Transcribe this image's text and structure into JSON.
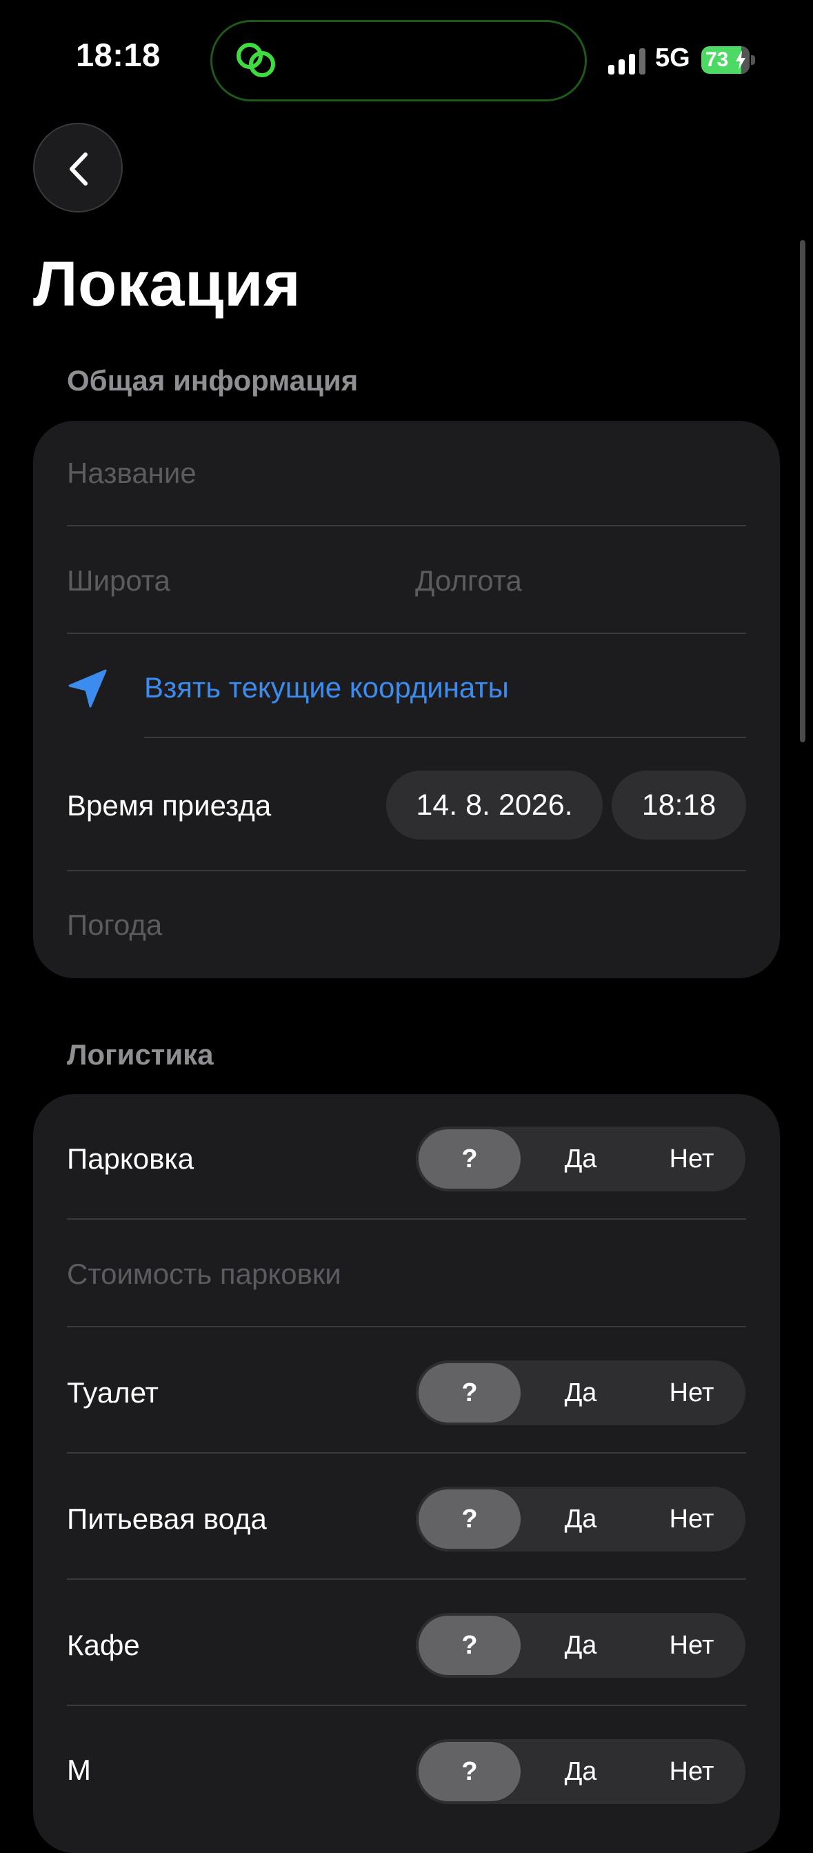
{
  "status_bar": {
    "time": "18:18",
    "network": "5G",
    "battery_percent": "73",
    "battery_level": 0.73,
    "battery_color": "#4cd964",
    "island_icon": "link-rings-icon",
    "island_accent": "#3fdc3f"
  },
  "header": {
    "back_icon": "chevron-left-icon",
    "title": "Локация"
  },
  "general": {
    "section_title": "Общая информация",
    "name_placeholder": "Название",
    "latitude_placeholder": "Широта",
    "longitude_placeholder": "Долгота",
    "location_icon": "location-arrow-icon",
    "current_coords_link": "Взять текущие координаты",
    "arrival_label": "Время приезда",
    "arrival_date": "14. 8. 2026.",
    "arrival_time": "18:18",
    "weather_placeholder": "Погода"
  },
  "logistics": {
    "section_title": "Логистика",
    "parking_label": "Парковка",
    "parking_cost_placeholder": "Стоимость парковки",
    "toilet_label": "Туалет",
    "water_label": "Питьевая вода",
    "cafe_label": "Кафе",
    "next_label": "М",
    "options": {
      "unknown": "?",
      "yes": "Да",
      "no": "Нет"
    },
    "selected": "?"
  },
  "colors": {
    "background": "#000000",
    "card": "#1c1c1e",
    "placeholder": "#5b5b60",
    "link": "#3c8cf0",
    "section_header": "#8e8e93"
  }
}
